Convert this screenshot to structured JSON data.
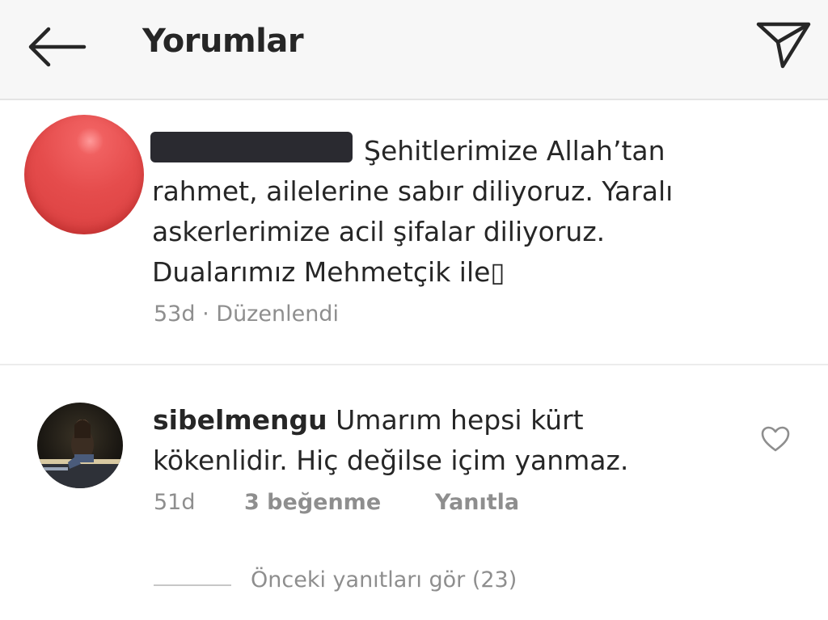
{
  "header": {
    "title": "Yorumlar",
    "back_icon": "arrow-left-icon",
    "send_icon": "paper-plane-icon"
  },
  "caption": {
    "text": "Şehitlerimize Allah’tan rahmet, ailelerine sabır diliyoruz. Yaralı askerlerimize acil şifalar diliyoruz. Dualarımız Mehmetçik ile▯",
    "time": "53d",
    "separator": "·",
    "edited": "Düzenlendi",
    "avatar_color": "#e54c4c"
  },
  "comment": {
    "username": "sibelmengu",
    "text": "Umarım hepsi kürt kökenlidir. Hiç değilse içim yanmaz.",
    "time": "51d",
    "likes": "3 beğenme",
    "reply_label": "Yanıtla",
    "like_icon": "heart-outline-icon"
  },
  "replies": {
    "label": "Önceki yanıtları gör (23)"
  },
  "colors": {
    "text": "#262626",
    "secondary": "#8e8e8e",
    "header_bg": "#f7f7f7"
  }
}
